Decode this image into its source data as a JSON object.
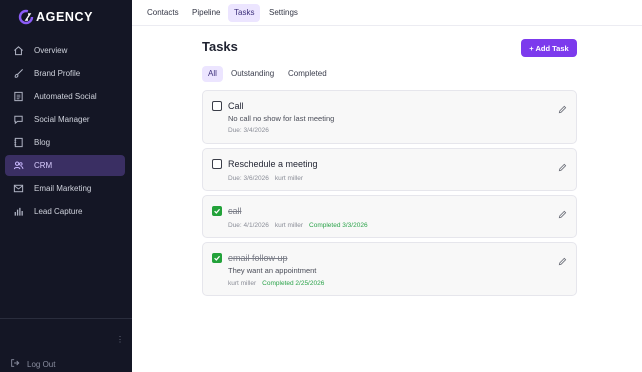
{
  "brand": {
    "name": "AGENCY"
  },
  "sidebar": {
    "items": [
      {
        "label": "Overview",
        "icon": "home-icon"
      },
      {
        "label": "Brand Profile",
        "icon": "brush-icon"
      },
      {
        "label": "Automated Social",
        "icon": "document-icon"
      },
      {
        "label": "Social Manager",
        "icon": "chat-icon"
      },
      {
        "label": "Blog",
        "icon": "notebook-icon"
      },
      {
        "label": "CRM",
        "icon": "users-icon"
      },
      {
        "label": "Email Marketing",
        "icon": "mail-icon"
      },
      {
        "label": "Lead Capture",
        "icon": "bar-chart-icon"
      }
    ],
    "active": "CRM",
    "logout_label": "Log Out"
  },
  "topnav": {
    "tabs": [
      "Contacts",
      "Pipeline",
      "Tasks",
      "Settings"
    ],
    "active": "Tasks"
  },
  "main": {
    "title": "Tasks",
    "add_label": "+ Add Task",
    "filters": [
      "All",
      "Outstanding",
      "Completed"
    ],
    "active_filter": "All",
    "tasks": [
      {
        "title": "Call",
        "description": "No call no show for last meeting",
        "due": "Due: 3/4/2026",
        "assignee": "",
        "completed": false,
        "completed_label": ""
      },
      {
        "title": "Reschedule a meeting",
        "description": "",
        "due": "Due: 3/6/2026",
        "assignee": "kurt miller",
        "completed": false,
        "completed_label": ""
      },
      {
        "title": "call",
        "description": "",
        "due": "Due: 4/1/2026",
        "assignee": "kurt miller",
        "completed": true,
        "completed_label": "Completed 3/3/2026"
      },
      {
        "title": "email follow up",
        "description": "They want an appointment",
        "due": "",
        "assignee": "kurt miller",
        "completed": true,
        "completed_label": "Completed 2/25/2026"
      }
    ]
  },
  "colors": {
    "sidebar_bg": "#141625",
    "accent": "#7c3aed",
    "active_tab_bg": "#ece5ff",
    "completed_green": "#23a23a"
  }
}
